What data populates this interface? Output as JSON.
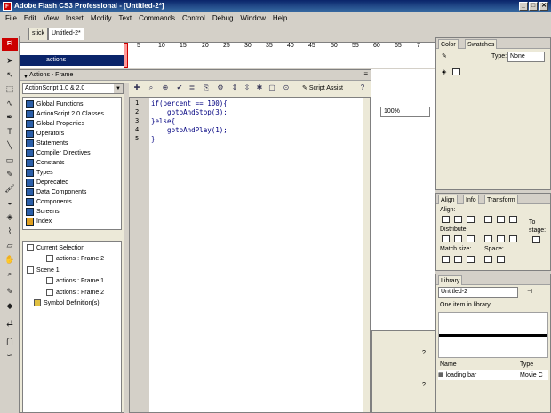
{
  "window": {
    "title": "Adobe Flash CS3 Professional - [Untitled-2*]",
    "app_badge": "Fl",
    "minimize": "_",
    "maximize": "□",
    "close": "✕"
  },
  "menu": [
    "File",
    "Edit",
    "View",
    "Insert",
    "Modify",
    "Text",
    "Commands",
    "Control",
    "Debug",
    "Window",
    "Help"
  ],
  "document": {
    "tabs": [
      "stick",
      "Untitled-2*"
    ],
    "layer_name": "actions",
    "frame_numbers": [
      "5",
      "10",
      "15",
      "20",
      "25",
      "30",
      "35",
      "40",
      "45",
      "50",
      "55",
      "60",
      "65",
      "7"
    ],
    "zoom": "100%"
  },
  "actions_panel": {
    "title": "Actions - Frame",
    "version_select": "ActionScript 1.0 & 2.0",
    "toolbox_items": [
      "Global Functions",
      "ActionScript 2.0 Classes",
      "Global Properties",
      "Operators",
      "Statements",
      "Compiler Directives",
      "Constants",
      "Types",
      "Deprecated",
      "Data Components",
      "Components",
      "Screens",
      "Index"
    ],
    "tree": {
      "current_selection": "Current Selection",
      "current_item": "actions : Frame 2",
      "scene": "Scene 1",
      "scene_items": [
        "actions : Frame 1",
        "actions : Frame 2"
      ],
      "symbols": "Symbol Definition(s)"
    },
    "script_assist": "Script Assist",
    "help": "?",
    "code_lines": [
      {
        "n": "1",
        "text": "if(percent == 100){"
      },
      {
        "n": "2",
        "text": "    gotoAndStop(3);"
      },
      {
        "n": "3",
        "text": "}else{"
      },
      {
        "n": "4",
        "text": "    gotoAndPlay(1);"
      },
      {
        "n": "5",
        "text": "}"
      }
    ]
  },
  "color_panel": {
    "tabs": [
      "Color",
      "Swatches"
    ],
    "type_label": "Type:",
    "type_value": "None"
  },
  "align_panel": {
    "tabs": [
      "Align",
      "Info",
      "Transform"
    ],
    "align_label": "Align:",
    "distribute_label": "Distribute:",
    "match_size_label": "Match size:",
    "space_label": "Space:",
    "to_stage_label": "To",
    "to_stage_label2": "stage:"
  },
  "library_panel": {
    "tab": "Library",
    "document": "Untitled-2",
    "count_text": "One item in library",
    "col_name": "Name",
    "col_type": "Type",
    "item_name": "loading bar",
    "item_type": "Movie C"
  }
}
